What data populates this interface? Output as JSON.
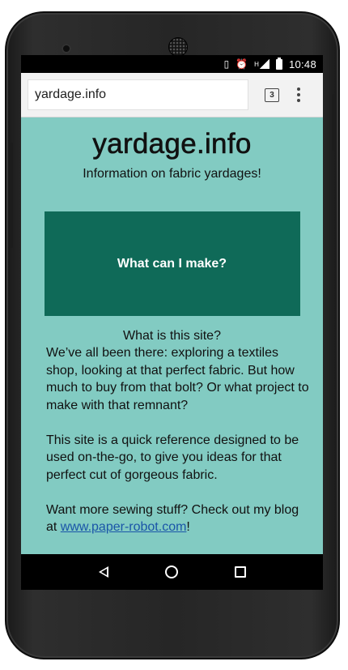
{
  "status_bar": {
    "time": "10:48",
    "icons": [
      "vibrate-icon",
      "alarm-icon",
      "signal-icon",
      "battery-icon"
    ],
    "network_label": "H"
  },
  "browser": {
    "url": "yardage.info",
    "tab_count": "3",
    "menu_icon": "more-vert-icon"
  },
  "page": {
    "title": "yardage.info",
    "tagline": "Information on fabric yardages!",
    "cta_label": "What can I make?",
    "about_heading": "What is this site?",
    "paragraph_1": "We’ve all been there: exploring a textiles shop, looking at that perfect fabric. But how much to buy from that bolt? Or what project to make with that remnant?",
    "paragraph_2": "This site is a quick reference designed to be used on-the-go, to give you ideas for that perfect cut of gorgeous fabric.",
    "paragraph_3_prefix": "Want more sewing stuff? Check out my blog at ",
    "blog_link": "www.paper-robot.com",
    "paragraph_3_suffix": "!"
  },
  "navigation": {
    "back": "back-icon",
    "home": "home-icon",
    "recents": "recents-icon"
  },
  "colors": {
    "page_background": "#82cbc2",
    "cta_background": "#0f6a58",
    "link": "#1a55a8"
  }
}
